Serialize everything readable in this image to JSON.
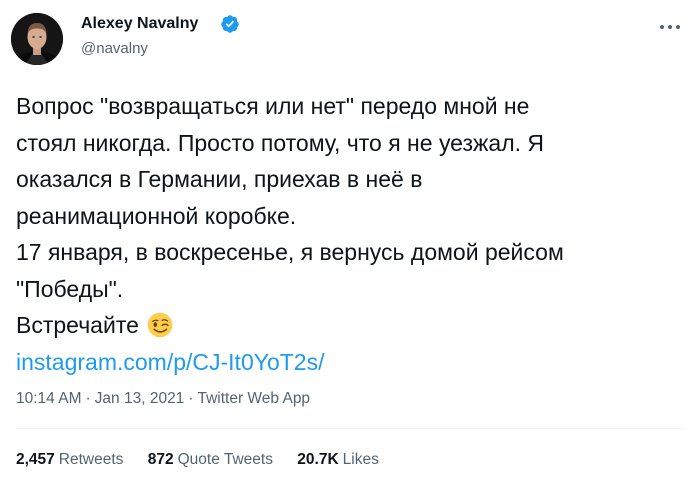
{
  "author": {
    "display_name": "Alexey Navalny",
    "handle": "@navalny",
    "verified": true
  },
  "tweet": {
    "lines": [
      "Вопрос \"возвращаться или нет\" передо мной не",
      "стоял никогда. Просто потому, что я не уезжал. Я",
      "оказался в Германии, приехав в неё в",
      "реанимационной коробке.",
      "17 января, в воскресенье, я вернусь домой рейсом",
      "\"Победы\".",
      "Встречайте"
    ],
    "emoji": "winking-face",
    "link": "instagram.com/p/CJ-It0YoT2s/"
  },
  "meta": {
    "time": "10:14 AM",
    "separator": "·",
    "date": "Jan 13, 2021",
    "source": "Twitter Web App"
  },
  "stats": {
    "retweets_count": "2,457",
    "retweets_label": "Retweets",
    "quote_count": "872",
    "quote_label": "Quote Tweets",
    "likes_count": "20.7K",
    "likes_label": "Likes"
  },
  "colors": {
    "link": "#1d9bf0",
    "secondary_text": "#536471",
    "primary_text": "#0f1419",
    "divider": "#eff3f4",
    "verified_badge": "#1d9bf0"
  },
  "icons": [
    "avatar",
    "verified-badge-icon",
    "more-options-icon",
    "winking-face-emoji"
  ]
}
